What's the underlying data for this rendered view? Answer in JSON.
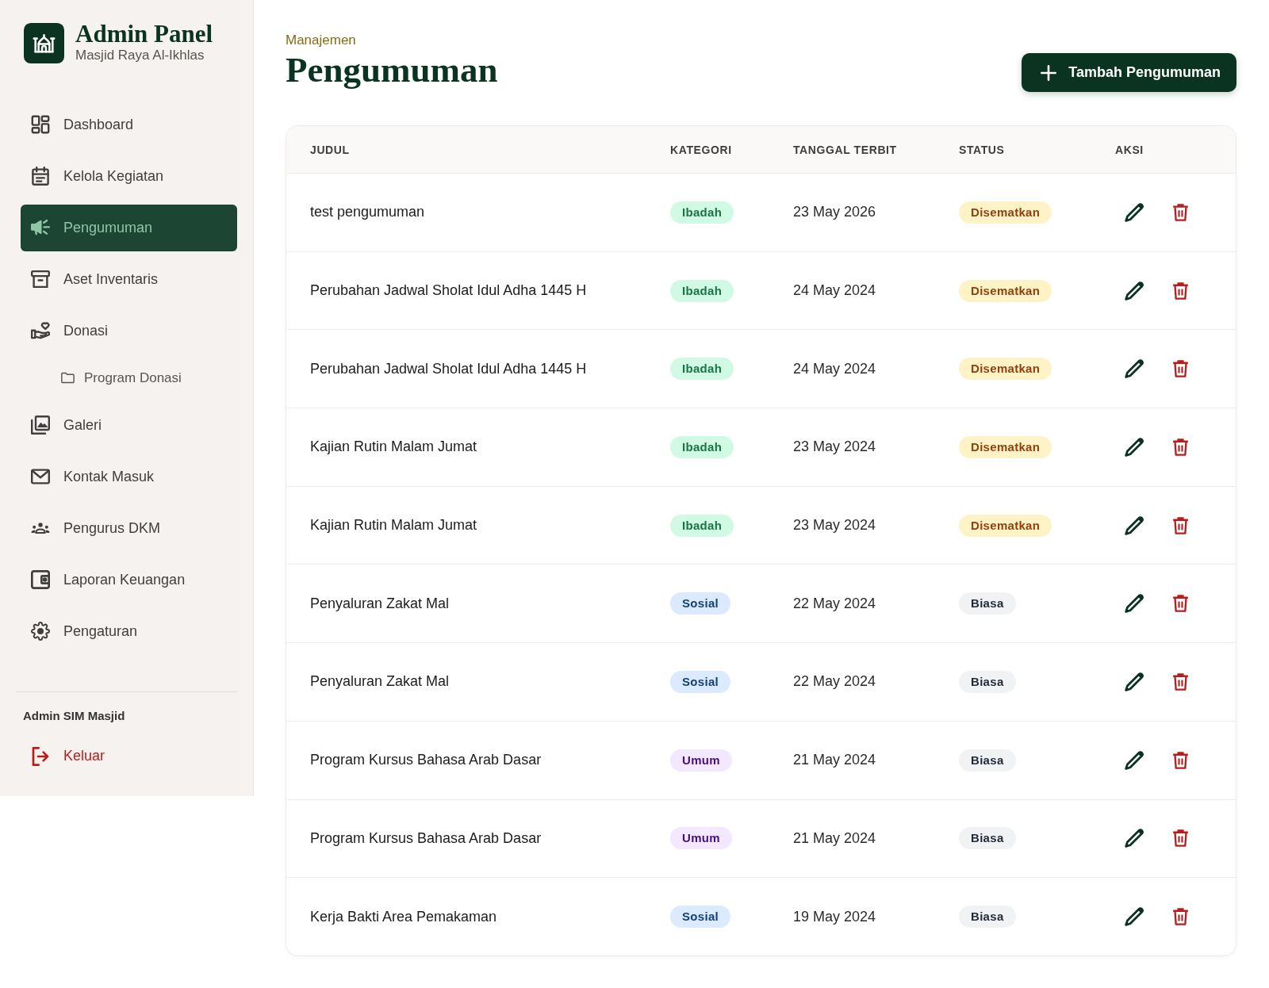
{
  "sidebar": {
    "brand": {
      "title": "Admin Panel",
      "subtitle": "Masjid Raya Al-Ikhlas"
    },
    "items": [
      {
        "label": "Dashboard",
        "selected": false
      },
      {
        "label": "Kelola Kegiatan",
        "selected": false
      },
      {
        "label": "Pengumuman",
        "selected": true
      },
      {
        "label": "Aset Inventaris",
        "selected": false
      },
      {
        "label": "Donasi",
        "selected": false,
        "children": [
          {
            "label": "Program Donasi",
            "selected": false
          }
        ]
      },
      {
        "label": "Galeri",
        "selected": false
      },
      {
        "label": "Kontak Masuk",
        "selected": false
      },
      {
        "label": "Pengurus DKM",
        "selected": false
      },
      {
        "label": "Laporan Keuangan",
        "selected": false
      },
      {
        "label": "Pengaturan",
        "selected": false
      }
    ],
    "user": "Admin SIM Masjid",
    "logout": "Keluar"
  },
  "header": {
    "section": "Manajemen",
    "title": "Pengumuman",
    "add_button": "Tambah Pengumuman"
  },
  "table": {
    "columns": [
      "JUDUL",
      "KATEGORI",
      "TANGGAL TERBIT",
      "STATUS",
      "AKSI"
    ],
    "rows": [
      {
        "title": "test pengumuman",
        "category": {
          "label": "Ibadah",
          "color": "#d1fae5"
        },
        "date": "23 May 2026",
        "status": {
          "label": "Disematkan",
          "pinned": true
        }
      },
      {
        "title": "Perubahan Jadwal Sholat Idul Adha 1445 H",
        "category": {
          "label": "Ibadah",
          "color": "#d1fae5"
        },
        "date": "24 May 2024",
        "status": {
          "label": "Disematkan",
          "pinned": true
        }
      },
      {
        "title": "Perubahan Jadwal Sholat Idul Adha 1445 H",
        "category": {
          "label": "Ibadah",
          "color": "#d1fae5"
        },
        "date": "24 May 2024",
        "status": {
          "label": "Disematkan",
          "pinned": true
        }
      },
      {
        "title": "Kajian Rutin Malam Jumat",
        "category": {
          "label": "Ibadah",
          "color": "#d1fae5"
        },
        "date": "23 May 2024",
        "status": {
          "label": "Disematkan",
          "pinned": true
        }
      },
      {
        "title": "Kajian Rutin Malam Jumat",
        "category": {
          "label": "Ibadah",
          "color": "#d1fae5"
        },
        "date": "23 May 2024",
        "status": {
          "label": "Disematkan",
          "pinned": true
        }
      },
      {
        "title": "Penyaluran Zakat Mal",
        "category": {
          "label": "Sosial",
          "color": "#dbeafe"
        },
        "date": "22 May 2024",
        "status": {
          "label": "Biasa",
          "pinned": false
        }
      },
      {
        "title": "Penyaluran Zakat Mal",
        "category": {
          "label": "Sosial",
          "color": "#dbeafe"
        },
        "date": "22 May 2024",
        "status": {
          "label": "Biasa",
          "pinned": false
        }
      },
      {
        "title": "Program Kursus Bahasa Arab Dasar",
        "category": {
          "label": "Umum",
          "color": "#f3e8ff"
        },
        "date": "21 May 2024",
        "status": {
          "label": "Biasa",
          "pinned": false
        }
      },
      {
        "title": "Program Kursus Bahasa Arab Dasar",
        "category": {
          "label": "Umum",
          "color": "#f3e8ff"
        },
        "date": "21 May 2024",
        "status": {
          "label": "Biasa",
          "pinned": false
        }
      },
      {
        "title": "Kerja Bakti Area Pemakaman",
        "category": {
          "label": "Sosial",
          "color": "#dbeafe"
        },
        "date": "19 May 2024",
        "status": {
          "label": "Biasa",
          "pinned": false
        }
      }
    ]
  }
}
